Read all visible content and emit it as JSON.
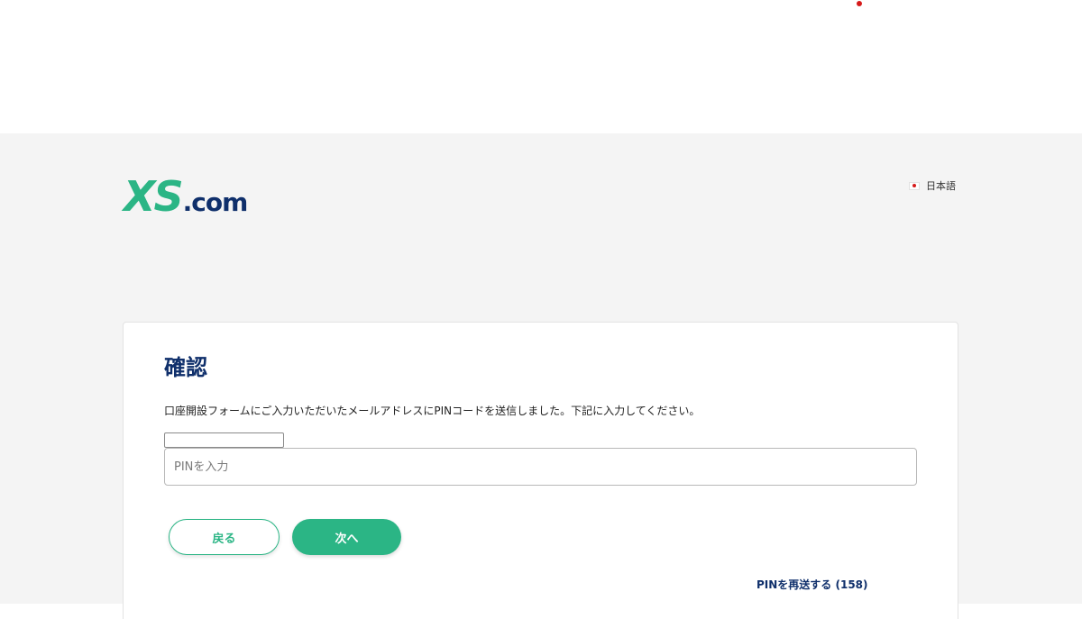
{
  "header": {
    "logo": {
      "primary": "XS",
      "suffix": ".com"
    },
    "language": {
      "label": "日本語",
      "flag_icon": "japan-flag-icon"
    }
  },
  "card": {
    "title": "確認",
    "description": "口座開設フォームにご入力いただいたメールアドレスにPINコードを送信しました。下記に入力してください。",
    "pin_input": {
      "value": "",
      "placeholder": "PINを入力"
    },
    "buttons": {
      "back_label": "戻る",
      "next_label": "次へ"
    },
    "resend_label": "PINを再送する (158)"
  },
  "colors": {
    "brand_green": "#2bb585",
    "brand_navy": "#0f2f6b",
    "background_gray": "#f4f4f4",
    "accent_red": "#d61a1a"
  }
}
